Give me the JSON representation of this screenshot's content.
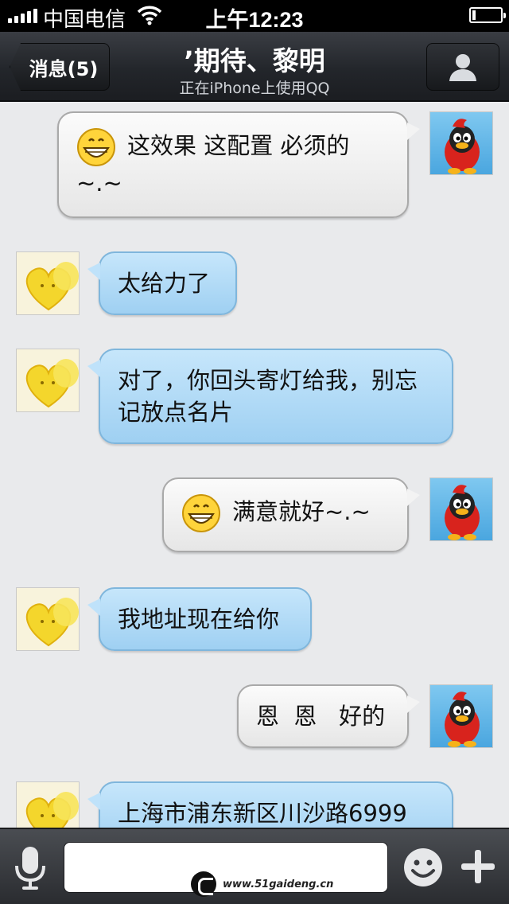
{
  "status_bar": {
    "carrier": "中国电信",
    "time": "上午12:23",
    "battery_level": 0.12
  },
  "nav": {
    "back_label": "消息(5)",
    "title": "’期待、黎明",
    "subtitle": "正在iPhone上使用QQ"
  },
  "messages": [
    {
      "direction": "out",
      "emoji": "grin-emoji",
      "text": "这效果   这配置 必须的~.~"
    },
    {
      "direction": "in",
      "text": "太给力了"
    },
    {
      "direction": "in",
      "text": "对了，你回头寄灯给我，别忘记放点名片"
    },
    {
      "direction": "out",
      "emoji": "grin-emoji",
      "text": "满意就好~.~"
    },
    {
      "direction": "in",
      "text": "我地址现在给你"
    },
    {
      "direction": "out",
      "text": "恩  恩   好的"
    },
    {
      "direction": "in",
      "text": "上海市浦东新区川沙路6999"
    }
  ],
  "input": {
    "value": "",
    "placeholder": ""
  },
  "watermark": "www.51gaideng.cn",
  "icons": {
    "mic": "microphone-icon",
    "emoji": "smiley-icon",
    "plus": "plus-icon",
    "profile": "person-icon"
  },
  "colors": {
    "incoming_bubble": "#a8d6f5",
    "outgoing_bubble": "#f0f0f0",
    "nav_bar": "#23262b"
  }
}
